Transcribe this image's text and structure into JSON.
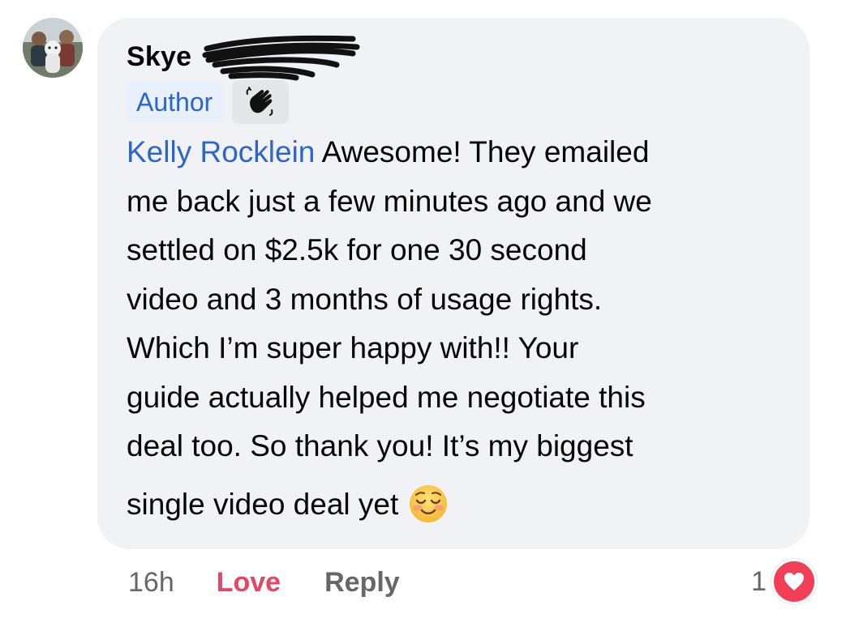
{
  "comment": {
    "author_name": "Skye",
    "author_badge": "Author",
    "wave_badge_icon": "waving-hand-icon",
    "mention": "Kelly Rocklein",
    "lines": [
      "Awesome! They emailed",
      "me back just a few minutes ago and we",
      "settled on $2.5k for one 30 second",
      "video and 3 months of usage rights.",
      "Which I’m super happy with!! Your",
      "guide actually helped me negotiate this",
      "deal too. So thank you! It’s my biggest"
    ],
    "last_line": "single video deal yet",
    "emoji": "smiling-face-emoji"
  },
  "actions": {
    "time": "16h",
    "love_label": "Love",
    "reply_label": "Reply"
  },
  "reactions": {
    "count": "1",
    "type": "heart-icon",
    "color": "#f33e58"
  },
  "colors": {
    "bubble": "#f0f2f5",
    "link": "#2d66c9",
    "love": "#e64563",
    "muted": "#65676b"
  }
}
